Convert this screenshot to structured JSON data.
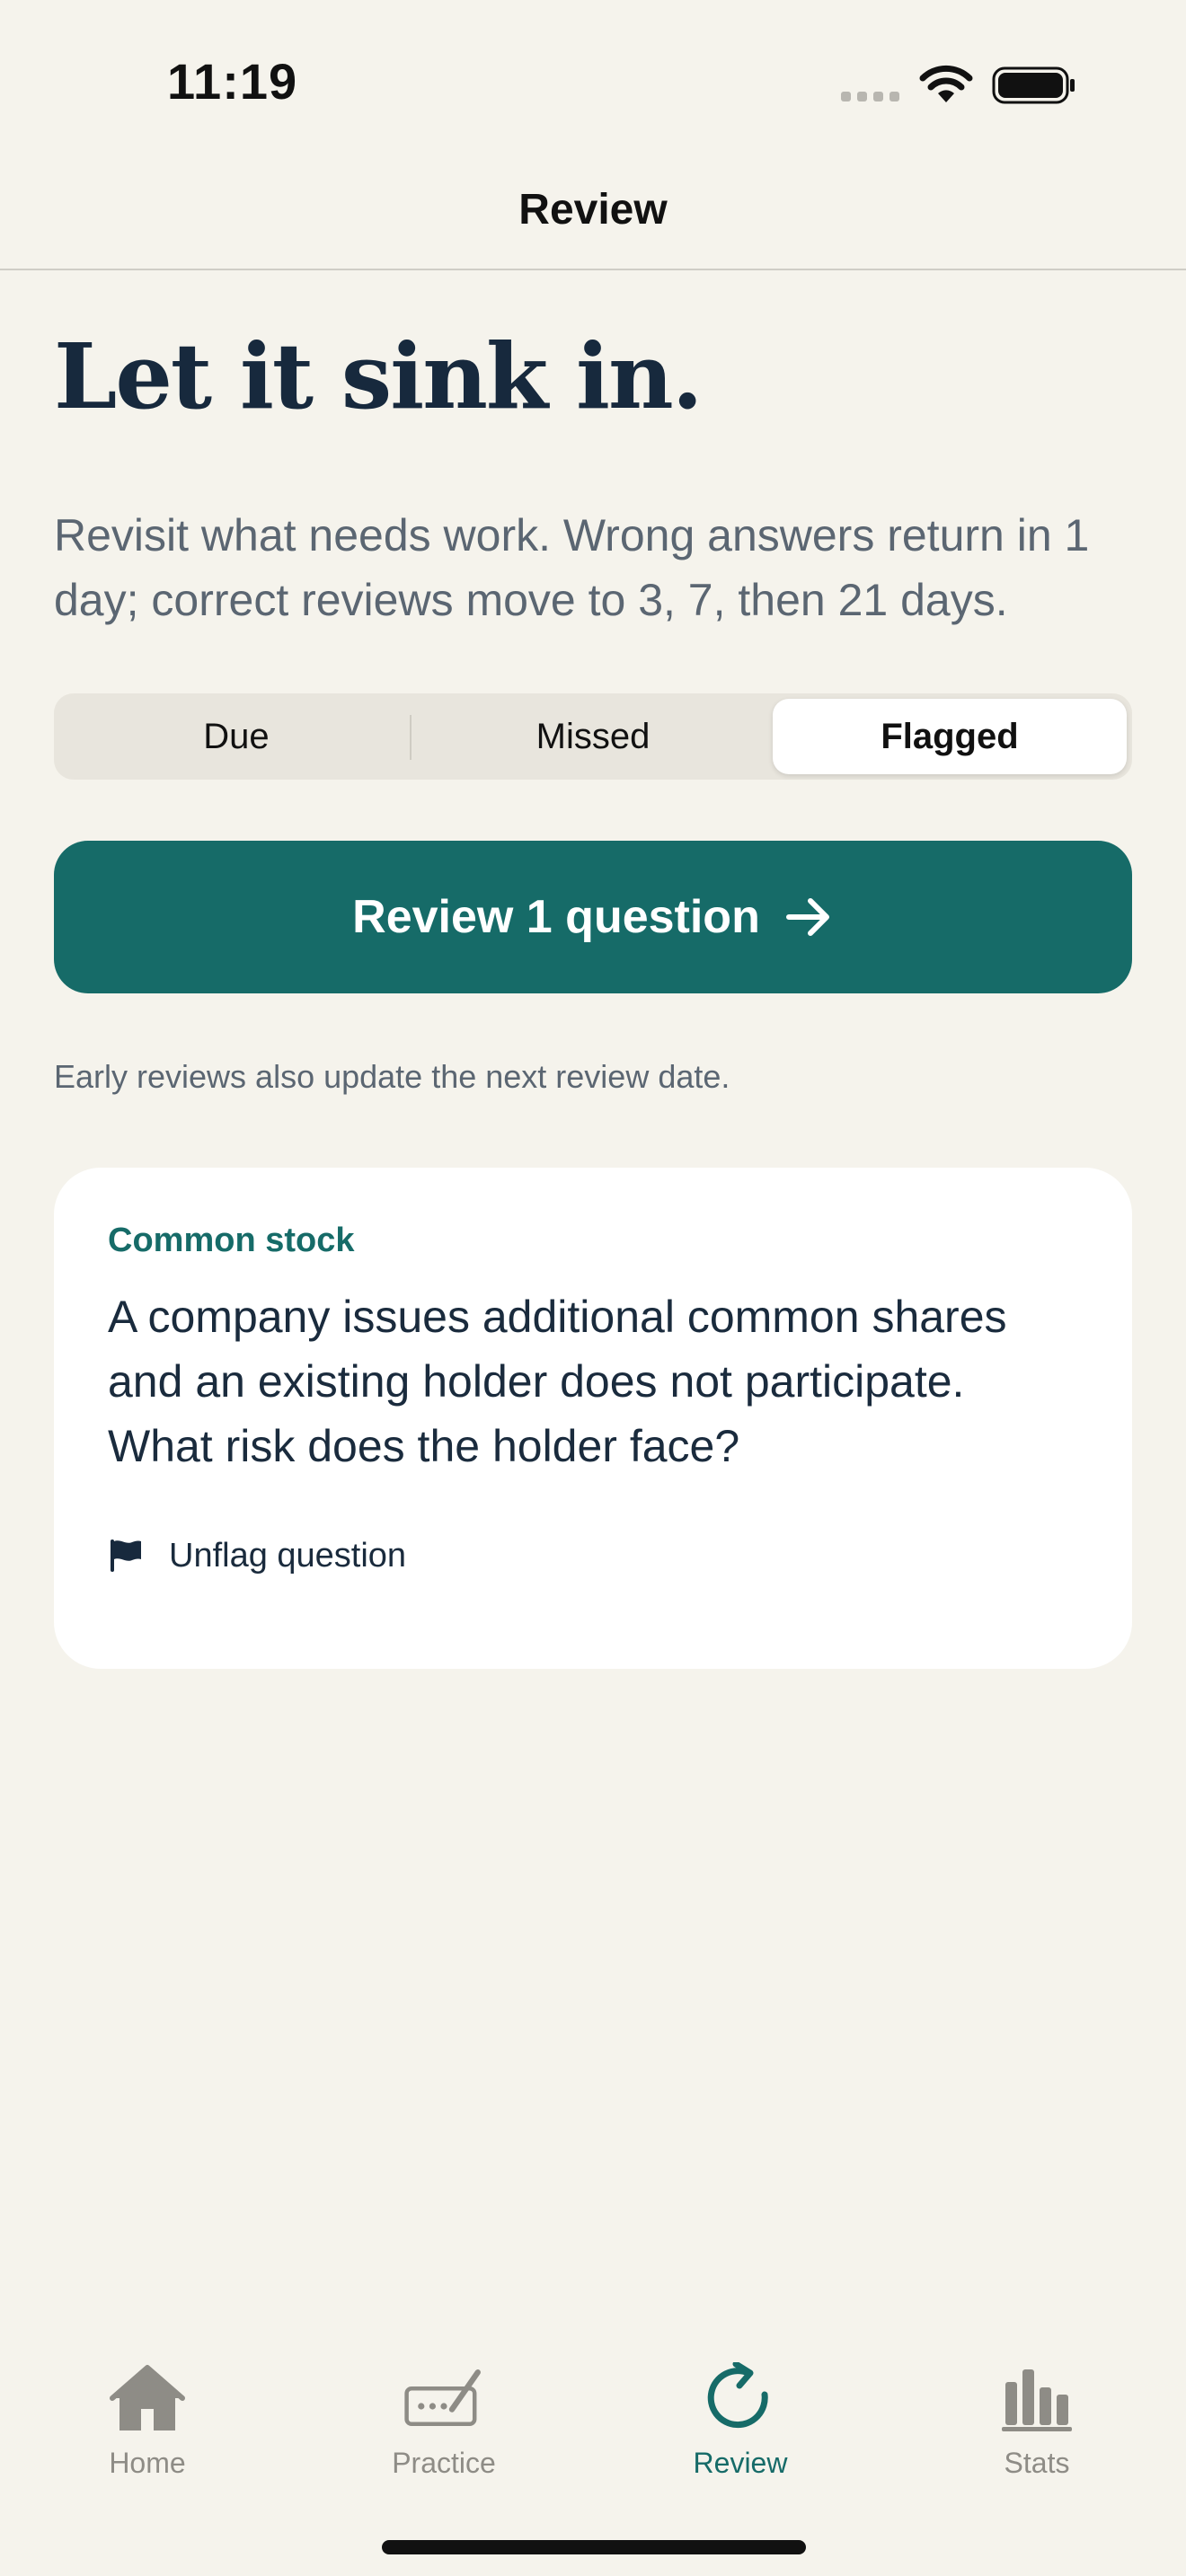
{
  "status_bar": {
    "time": "11:19"
  },
  "header": {
    "title": "Review"
  },
  "hero": {
    "title": "Let it sink in.",
    "subtitle": "Revisit what needs work. Wrong answers return in 1 day; correct reviews move to 3, 7, then 21 days."
  },
  "filter": {
    "segments": [
      {
        "label": "Due",
        "selected": false
      },
      {
        "label": "Missed",
        "selected": false
      },
      {
        "label": "Flagged",
        "selected": true
      }
    ]
  },
  "primary_action": {
    "label": "Review 1 question",
    "icon": "arrow-right-icon"
  },
  "helper_text": "Early reviews also update the next review date.",
  "card": {
    "category": "Common stock",
    "question": "A company issues additional common shares and an existing holder does not participate. What risk does the holder face?",
    "action_label": "Unflag question",
    "action_icon": "flag-icon"
  },
  "tab_bar": {
    "tabs": [
      {
        "label": "Home",
        "icon": "house-icon",
        "active": false
      },
      {
        "label": "Practice",
        "icon": "pencil-pad-icon",
        "active": false
      },
      {
        "label": "Review",
        "icon": "refresh-icon",
        "active": true
      },
      {
        "label": "Stats",
        "icon": "bar-chart-icon",
        "active": false
      }
    ]
  },
  "colors": {
    "background": "#f5f3ec",
    "accent": "#166b68",
    "text_primary": "#17293d",
    "text_secondary": "#5b6672",
    "tab_inactive": "#8e8c86"
  }
}
